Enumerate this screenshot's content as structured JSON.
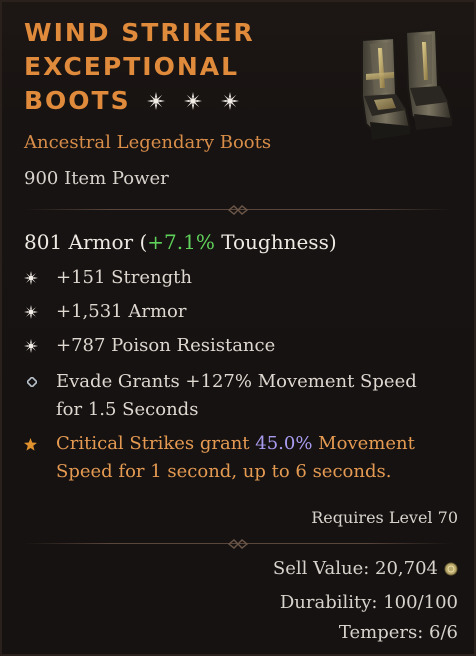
{
  "item": {
    "name_line1": "WIND STRIKER",
    "name_line2": "EXCEPTIONAL",
    "name_line3": "BOOTS",
    "stars_count": 3,
    "type": "Ancestral Legendary Boots",
    "item_power": "900 Item Power",
    "icon": "boots-icon"
  },
  "armor": {
    "value": "801 Armor (",
    "delta": "+7.1%",
    "suffix": " Toughness)"
  },
  "stats": [
    {
      "text": "+151 Strength",
      "icon": "greater-affix-star-icon"
    },
    {
      "text": "+1,531 Armor",
      "icon": "greater-affix-star-icon"
    },
    {
      "text": "+787 Poison Resistance",
      "icon": "greater-affix-star-icon"
    }
  ],
  "implicit": {
    "line1": "Evade Grants +127% Movement Speed",
    "line2": "for 1.5 Seconds",
    "icon": "diamond-bullet-icon"
  },
  "legendary": {
    "pre": "Critical Strikes grant ",
    "value": "45.0%",
    "post": " Movement",
    "line2": "Speed for 1 second, up to 6 seconds.",
    "icon": "legendary-star-icon"
  },
  "requires": "Requires Level 70",
  "footer": {
    "sell_value": "Sell Value: 20,704",
    "durability": "Durability: 100/100",
    "tempers": "Tempers: 6/6",
    "gold_icon": "gold-coin-icon"
  },
  "colors": {
    "title": "#e08a3c",
    "legendary": "#e59a52",
    "positive": "#5fd15a",
    "highlight": "#a99cf0",
    "background": "#151211"
  }
}
